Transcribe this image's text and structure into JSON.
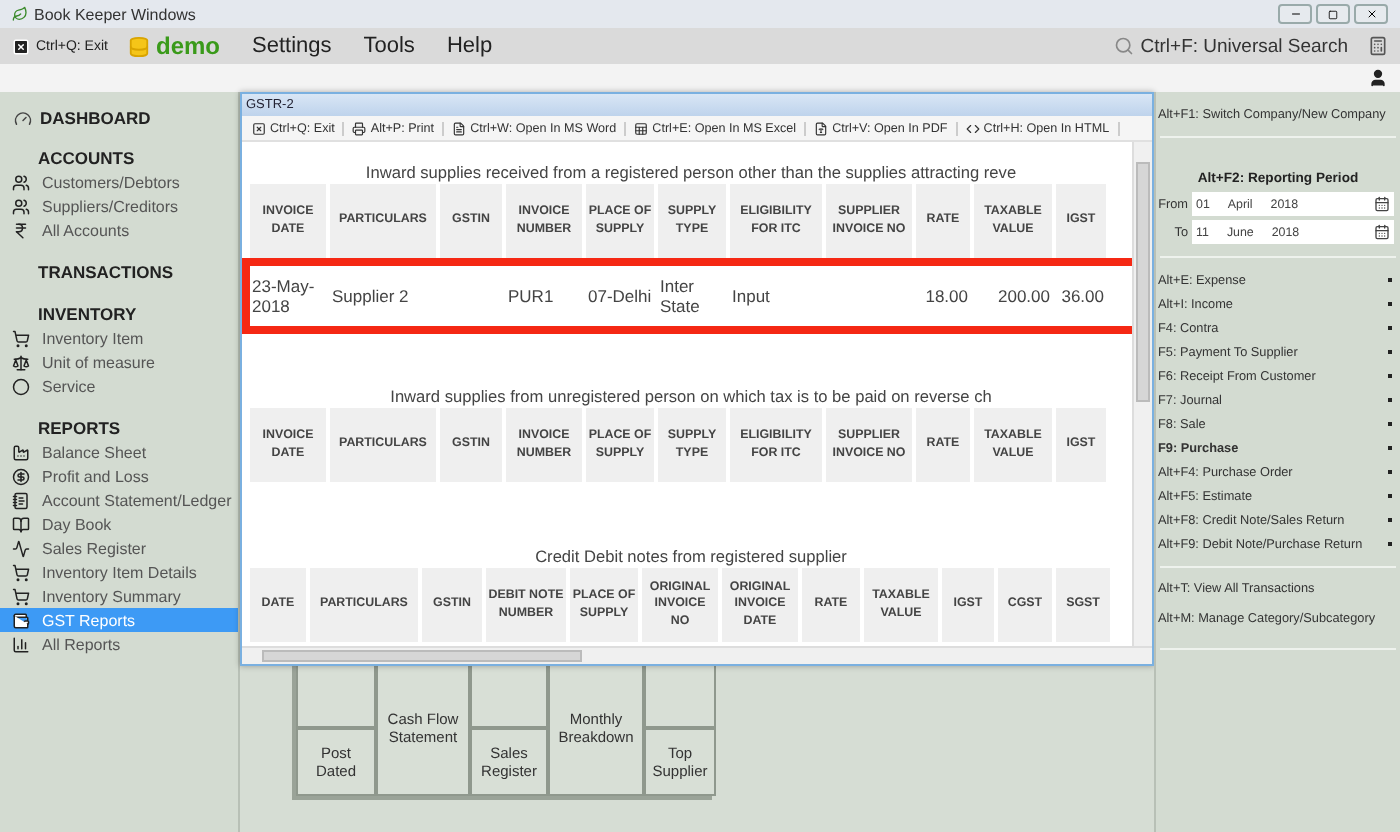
{
  "window": {
    "title": "Book Keeper Windows"
  },
  "menu_bar": {
    "exit": "Ctrl+Q: Exit",
    "company": "demo",
    "menus": [
      "Settings",
      "Tools",
      "Help"
    ],
    "search": "Ctrl+F: Universal Search"
  },
  "sidebar": {
    "dashboard": "DASHBOARD",
    "sections": [
      {
        "title": "ACCOUNTS",
        "items": [
          {
            "label": "Customers/Debtors",
            "selected": false
          },
          {
            "label": "Suppliers/Creditors",
            "selected": false
          },
          {
            "label": "All Accounts",
            "selected": false
          }
        ]
      },
      {
        "title": "TRANSACTIONS"
      },
      {
        "title": "INVENTORY",
        "items": [
          {
            "label": "Inventory Item",
            "selected": false
          },
          {
            "label": "Unit of measure",
            "selected": false
          },
          {
            "label": "Service",
            "selected": false
          }
        ]
      },
      {
        "title": "REPORTS",
        "items": [
          {
            "label": "Balance Sheet",
            "selected": false
          },
          {
            "label": "Profit and Loss",
            "selected": false
          },
          {
            "label": "Account Statement/Ledger",
            "selected": false
          },
          {
            "label": "Day Book",
            "selected": false
          },
          {
            "label": "Sales Register",
            "selected": false
          },
          {
            "label": "Inventory Item Details",
            "selected": false
          },
          {
            "label": "Inventory Summary",
            "selected": false
          },
          {
            "label": "GST Reports",
            "selected": true
          },
          {
            "label": "All Reports",
            "selected": false
          }
        ]
      }
    ]
  },
  "report_buttons": [
    "Cash Flow Statement",
    "Monthly Breakdown",
    "Post Dated",
    "Sales Register",
    "Top Supplier"
  ],
  "dialog": {
    "title": "GSTR-2",
    "toolbar": [
      "Ctrl+Q: Exit",
      "Alt+P: Print",
      "Ctrl+W: Open In MS Word",
      "Ctrl+E: Open In MS Excel",
      "Ctrl+V: Open In PDF",
      "Ctrl+H: Open In HTML"
    ],
    "sections": [
      {
        "title": "Inward supplies received from a registered person other than the supplies attracting reve",
        "columns": [
          "INVOICE DATE",
          "PARTICULARS",
          "GSTIN",
          "INVOICE NUMBER",
          "PLACE OF SUPPLY",
          "SUPPLY TYPE",
          "ELIGIBILITY FOR ITC",
          "SUPPLIER INVOICE NO",
          "RATE",
          "TAXABLE VALUE",
          "IGST"
        ],
        "rows": [
          {
            "cells": [
              "23-May-2018",
              "Supplier 2",
              null,
              "PUR1",
              "07-Delhi",
              "Inter State",
              "Input",
              null,
              "18.00",
              "200.00",
              "36.00"
            ],
            "highlighted": true
          }
        ]
      },
      {
        "title": "Inward supplies from unregistered person on which tax is to be paid on reverse ch",
        "columns": [
          "INVOICE DATE",
          "PARTICULARS",
          "GSTIN",
          "INVOICE NUMBER",
          "PLACE OF SUPPLY",
          "SUPPLY TYPE",
          "ELIGIBILITY FOR ITC",
          "SUPPLIER INVOICE NO",
          "RATE",
          "TAXABLE VALUE",
          "IGST"
        ]
      },
      {
        "title": "Credit Debit notes from registered supplier",
        "columns": [
          "DATE",
          "PARTICULARS",
          "GSTIN",
          "DEBIT NOTE NUMBER",
          "PLACE OF SUPPLY",
          "ORIGINAL INVOICE NO",
          "ORIGINAL INVOICE DATE",
          "RATE",
          "TAXABLE VALUE",
          "IGST",
          "CGST",
          "SGST"
        ]
      }
    ]
  },
  "right_panel": {
    "switch_company": "Alt+F1: Switch Company/New Company",
    "reporting_period": {
      "title": "Alt+F2: Reporting Period",
      "from": {
        "label": "From",
        "day": "01",
        "month": "April",
        "year": "2018"
      },
      "to": {
        "label": "To",
        "day": "11",
        "month": "June",
        "year": "2018"
      }
    },
    "transactions": [
      {
        "label": "Alt+E: Expense",
        "selected": false
      },
      {
        "label": "Alt+I: Income",
        "selected": false
      },
      {
        "label": "F4: Contra",
        "selected": false
      },
      {
        "label": "F5: Payment To Supplier",
        "selected": false
      },
      {
        "label": "F6: Receipt From Customer",
        "selected": false
      },
      {
        "label": "F7: Journal",
        "selected": false
      },
      {
        "label": "F8: Sale",
        "selected": false
      },
      {
        "label": "F9: Purchase",
        "selected": true
      },
      {
        "label": "Alt+F4: Purchase Order",
        "selected": false
      },
      {
        "label": "Alt+F5: Estimate",
        "selected": false
      },
      {
        "label": "Alt+F8: Credit Note/Sales Return",
        "selected": false
      },
      {
        "label": "Alt+F9: Debit Note/Purchase Return",
        "selected": false
      }
    ],
    "links": [
      "Alt+T: View All Transactions",
      "Alt+M: Manage Category/Subcategory"
    ]
  }
}
